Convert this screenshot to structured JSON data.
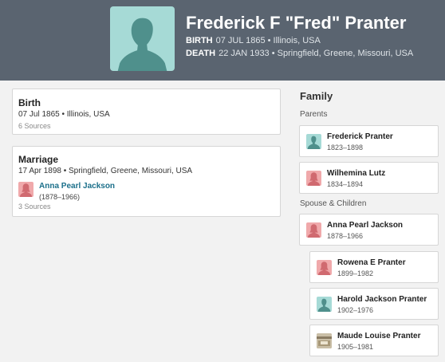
{
  "header": {
    "name": "Frederick F \"Fred\" Pranter",
    "birth_label": "BIRTH",
    "birth_value": "07 JUL 1865 • Illinois, USA",
    "death_label": "DEATH",
    "death_value": "22 JAN 1933 • Springfield, Greene, Missouri, USA",
    "avatar_icon": "male-silhouette-icon"
  },
  "birth": {
    "title": "Birth",
    "detail": "07 Jul 1865 • Illinois, USA",
    "sources": "6 Sources"
  },
  "marriage": {
    "title": "Marriage",
    "detail": "17 Apr 1898 • Springfield, Greene, Missouri, USA",
    "spouse_name": "Anna Pearl Jackson",
    "spouse_dates": "(1878–1966)",
    "sources": "3 Sources"
  },
  "family": {
    "heading": "Family",
    "parents_label": "Parents",
    "spouse_children_label": "Spouse & Children",
    "parents": [
      {
        "name": "Frederick Pranter",
        "dates": "1823–1898",
        "avatar": "male-silhouette-icon"
      },
      {
        "name": "Wilhemina Lutz",
        "dates": "1834–1894",
        "avatar": "female-silhouette-icon"
      }
    ],
    "spouse": {
      "name": "Anna Pearl Jackson",
      "dates": "1878–1966",
      "avatar": "female-silhouette-icon"
    },
    "children": [
      {
        "name": "Rowena E Pranter",
        "dates": "1899–1982",
        "avatar": "female-silhouette-icon"
      },
      {
        "name": "Harold Jackson Pranter",
        "dates": "1902–1976",
        "avatar": "male-silhouette-icon"
      },
      {
        "name": "Maude Louise Pranter",
        "dates": "1905–1981",
        "avatar": "photo-thumbnail-icon"
      }
    ]
  },
  "colors": {
    "header_bg": "#5a6470",
    "male_avatar": "#a6dad6",
    "female_avatar": "#f0a9ab",
    "link": "#1b6f8a"
  }
}
